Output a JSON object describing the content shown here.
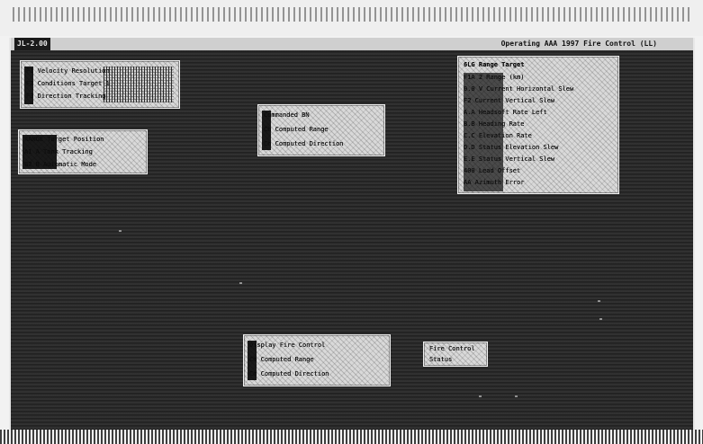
{
  "header": {
    "left": "JL-2.00",
    "right": "Operating AAA 1997 Fire Control (LL)"
  },
  "panels": {
    "left_top": {
      "rows": [
        "F1 Velocity    Resolution",
        "F2 Conditions  Target 1",
        "F3 Direction   Tracking"
      ]
    },
    "left_mid": {
      "rows": [
        "RANGE  Target Position",
        "A1 A  Tank Tracking",
        "B2 B  Automatic Mode"
      ]
    },
    "center": {
      "rows": [
        "Commanded   BN",
        "Ch Computed Range",
        "Ch Computed Direction"
      ]
    },
    "right_status": {
      "title": "6LG  Range Target",
      "rows": [
        "F1A   2  Range (km)",
        "0.0  V  Current Horizontal Slew",
        "F2   Current Vertical Slew",
        "A.A   Headsoft Rate Left",
        "B.B   Heading Rate",
        "C.C   Elevation Rate",
        "D.D   Status Elevation Slew",
        "E.E   Status Vertical Slew",
        "400   Lead Offset",
        "AA   Azimuth Error"
      ]
    },
    "bottom_center": {
      "rows": [
        "Display   Fire Control",
        "Ch Computed Range",
        "Ch Computed Direction"
      ]
    },
    "bottom_right": {
      "rows": [
        "Fire Control",
        "Status"
      ]
    }
  }
}
